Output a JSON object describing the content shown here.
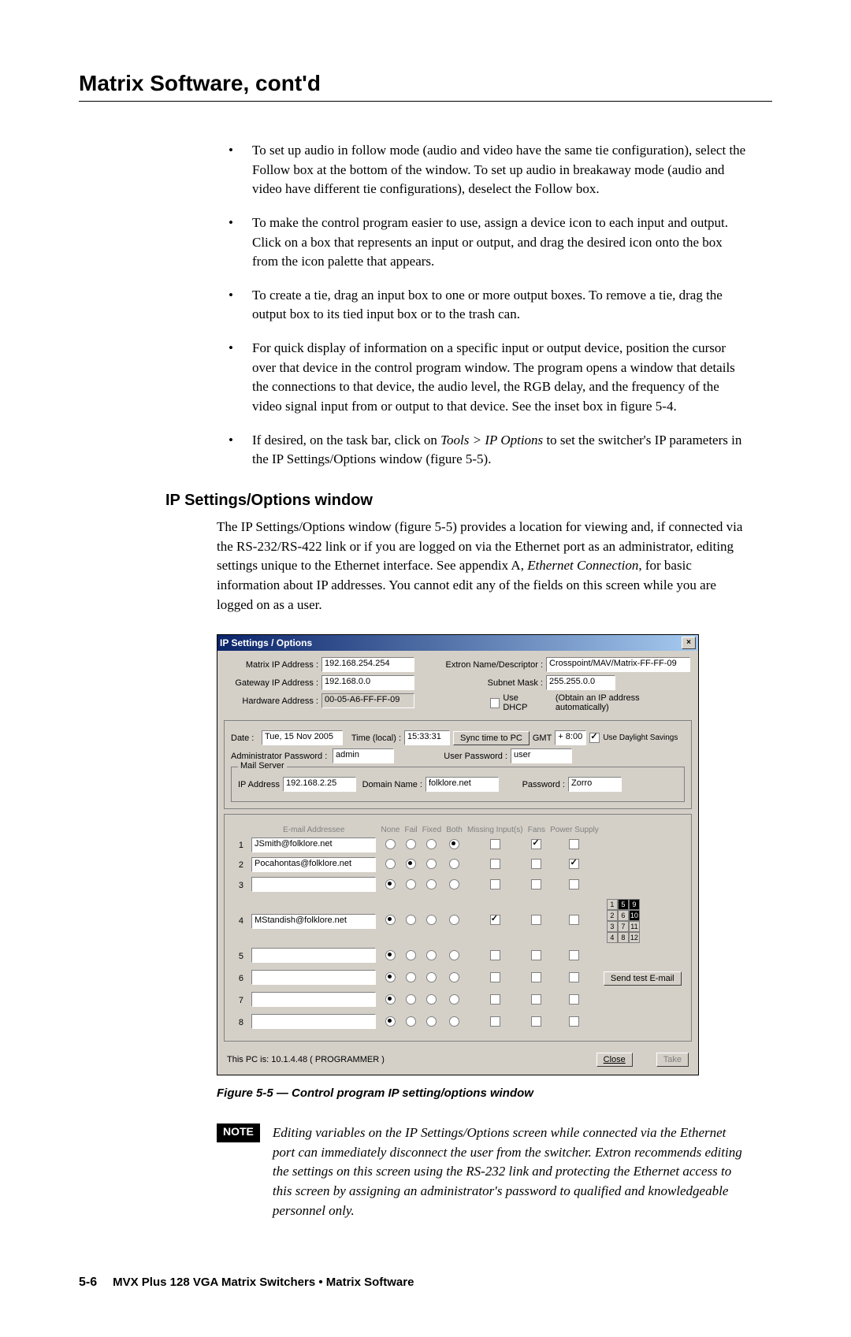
{
  "header": {
    "title": "Matrix Software, cont'd"
  },
  "bullets": [
    "To set up audio in follow mode (audio and video have the same tie configuration), select the Follow box at the bottom of the window.  To set up audio in breakaway mode (audio and video have different tie configurations), deselect the Follow box.",
    "To make the control program easier to use, assign a device icon to each input and output.  Click on a box that represents an input or output, and drag the desired icon onto the box from the icon palette that appears.",
    "To create a tie, drag an input box to one or more output boxes.  To remove a tie, drag the output box to its tied input box or to the trash can.",
    "For quick display of information on a specific input or output device, position the cursor over that device in the control program window.  The program opens a window that details the connections to that device, the audio level, the RGB delay, and the frequency of the video signal input from or output to that device.  See the inset box in figure 5-4."
  ],
  "bullet5_prefix": "If desired, on the task bar, click on ",
  "bullet5_italic": "Tools > IP Options",
  "bullet5_suffix": " to set the switcher's IP parameters in the IP Settings/Options window (figure 5-5).",
  "h2": "IP Settings/Options window",
  "para_prefix": "The IP Settings/Options window (figure 5-5) provides a location for viewing and, if connected via the RS-232/RS-422 link or if you are logged on via the Ethernet port as an administrator, editing settings unique to the Ethernet interface.  See appendix A, ",
  "para_italic": "Ethernet Connection",
  "para_suffix": ", for basic information about IP addresses.  You cannot edit any of the fields on this screen while you are logged on as a user.",
  "dialog": {
    "title": "IP Settings / Options",
    "matrix_ip_lbl": "Matrix IP Address :",
    "matrix_ip": "192.168.254.254",
    "gateway_lbl": "Gateway IP Address :",
    "gateway": "192.168.0.0",
    "hw_lbl": "Hardware Address :",
    "hw": "00-05-A6-FF-FF-09",
    "extron_lbl": "Extron Name/Descriptor :",
    "extron": "Crosspoint/MAV/Matrix-FF-FF-09",
    "subnet_lbl": "Subnet Mask :",
    "subnet": "255.255.0.0",
    "dhcp_lbl": "Use DHCP",
    "dhcp_hint": "(Obtain an IP address automatically)",
    "date_lbl": "Date :",
    "date": "Tue, 15 Nov 2005",
    "time_lbl": "Time (local) :",
    "time": "15:33:31",
    "sync_btn": "Sync time to PC",
    "gmt_lbl": "GMT",
    "gmt": "+ 8:00",
    "dst_lbl": "Use Daylight Savings",
    "admin_pwd_lbl": "Administrator Password :",
    "admin_pwd": "admin",
    "user_pwd_lbl": "User Password :",
    "user_pwd": "user",
    "mail_group": "Mail Server",
    "mail_ip_lbl": "IP Address",
    "mail_ip": "192.168.2.25",
    "domain_lbl": "Domain Name :",
    "domain": "folklore.net",
    "mail_pwd_lbl": "Password :",
    "mail_pwd": "Zorro",
    "col_addr": "E-mail Addressee",
    "col_none": "None",
    "col_fail": "Fail",
    "col_fixed": "Fixed",
    "col_both": "Both",
    "col_missing": "Missing Input(s)",
    "col_fans": "Fans",
    "col_power": "Power Supply",
    "rows": [
      {
        "n": "1",
        "addr": "JSmith@folklore.net",
        "sel": "both",
        "missing": false,
        "fans": true,
        "power": false
      },
      {
        "n": "2",
        "addr": "Pocahontas@folklore.net",
        "sel": "fail",
        "missing": false,
        "fans": false,
        "power": true
      },
      {
        "n": "3",
        "addr": "",
        "sel": "none",
        "missing": false,
        "fans": false,
        "power": false
      },
      {
        "n": "4",
        "addr": "MStandish@folklore.net",
        "sel": "none",
        "missing": true,
        "fans": false,
        "power": false
      },
      {
        "n": "5",
        "addr": "",
        "sel": "none",
        "missing": false,
        "fans": false,
        "power": false
      },
      {
        "n": "6",
        "addr": "",
        "sel": "none",
        "missing": false,
        "fans": false,
        "power": false
      },
      {
        "n": "7",
        "addr": "",
        "sel": "none",
        "missing": false,
        "fans": false,
        "power": false
      },
      {
        "n": "8",
        "addr": "",
        "sel": "none",
        "missing": false,
        "fans": false,
        "power": false
      }
    ],
    "send_test_btn": "Send test E-mail",
    "this_pc": "This PC is:   10.1.4.48   ( PROGRAMMER )",
    "close_btn": "Close",
    "take_btn": "Take"
  },
  "caption": "Figure 5-5 — Control program IP setting/options window",
  "note_label": "NOTE",
  "note_text": "Editing variables on the IP Settings/Options screen while connected via the Ethernet port can immediately disconnect the user from the switcher.  Extron recommends editing the settings on this screen using the RS-232 link and protecting the Ethernet access to this screen by assigning an administrator's password to qualified and knowledgeable personnel only.",
  "footer": {
    "page": "5-6",
    "text": "MVX Plus 128 VGA Matrix Switchers • Matrix Software"
  }
}
